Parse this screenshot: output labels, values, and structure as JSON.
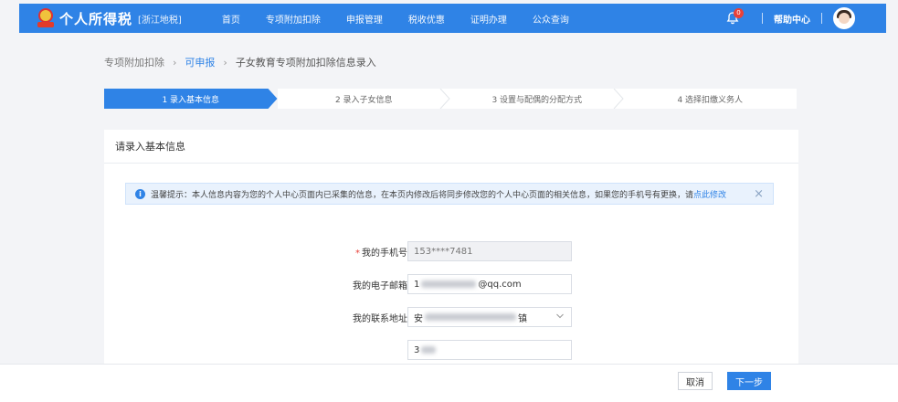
{
  "header": {
    "brand": "个人所得税",
    "region": "[浙江地税]",
    "nav": [
      "首页",
      "专项附加扣除",
      "申报管理",
      "税收优惠",
      "证明办理",
      "公众查询"
    ],
    "notification_count": "0",
    "help": "帮助中心"
  },
  "breadcrumb": {
    "item1": "专项附加扣除",
    "item2": "可申报",
    "item3": "子女教育专项附加扣除信息录入"
  },
  "steps": [
    {
      "label": "1 录入基本信息",
      "active": true
    },
    {
      "label": "2 录入子女信息",
      "active": false
    },
    {
      "label": "3 设置与配偶的分配方式",
      "active": false
    },
    {
      "label": "4 选择扣缴义务人",
      "active": false
    }
  ],
  "card": {
    "title": "请录入基本信息"
  },
  "notice": {
    "prefix": "温馨提示：本人信息内容为您的个人中心页面内已采集的信息，在本页内修改后将同步修改您的个人中心页面的相关信息，如果您的手机号有更换，请",
    "link": "点此修改",
    "close": "×"
  },
  "form": {
    "phone_label": "我的手机号",
    "phone_value": "153****7481",
    "email_label": "我的电子邮箱",
    "email_prefix": "1",
    "email_suffix": "@qq.com",
    "address_label": "我的联系地址",
    "address_prefix": "安",
    "address_suffix": "镇",
    "address_detail_prefix": "3"
  },
  "footer": {
    "cancel": "取消",
    "next": "下一步"
  },
  "colors": {
    "primary": "#2f83e6",
    "required": "#e8413a"
  }
}
